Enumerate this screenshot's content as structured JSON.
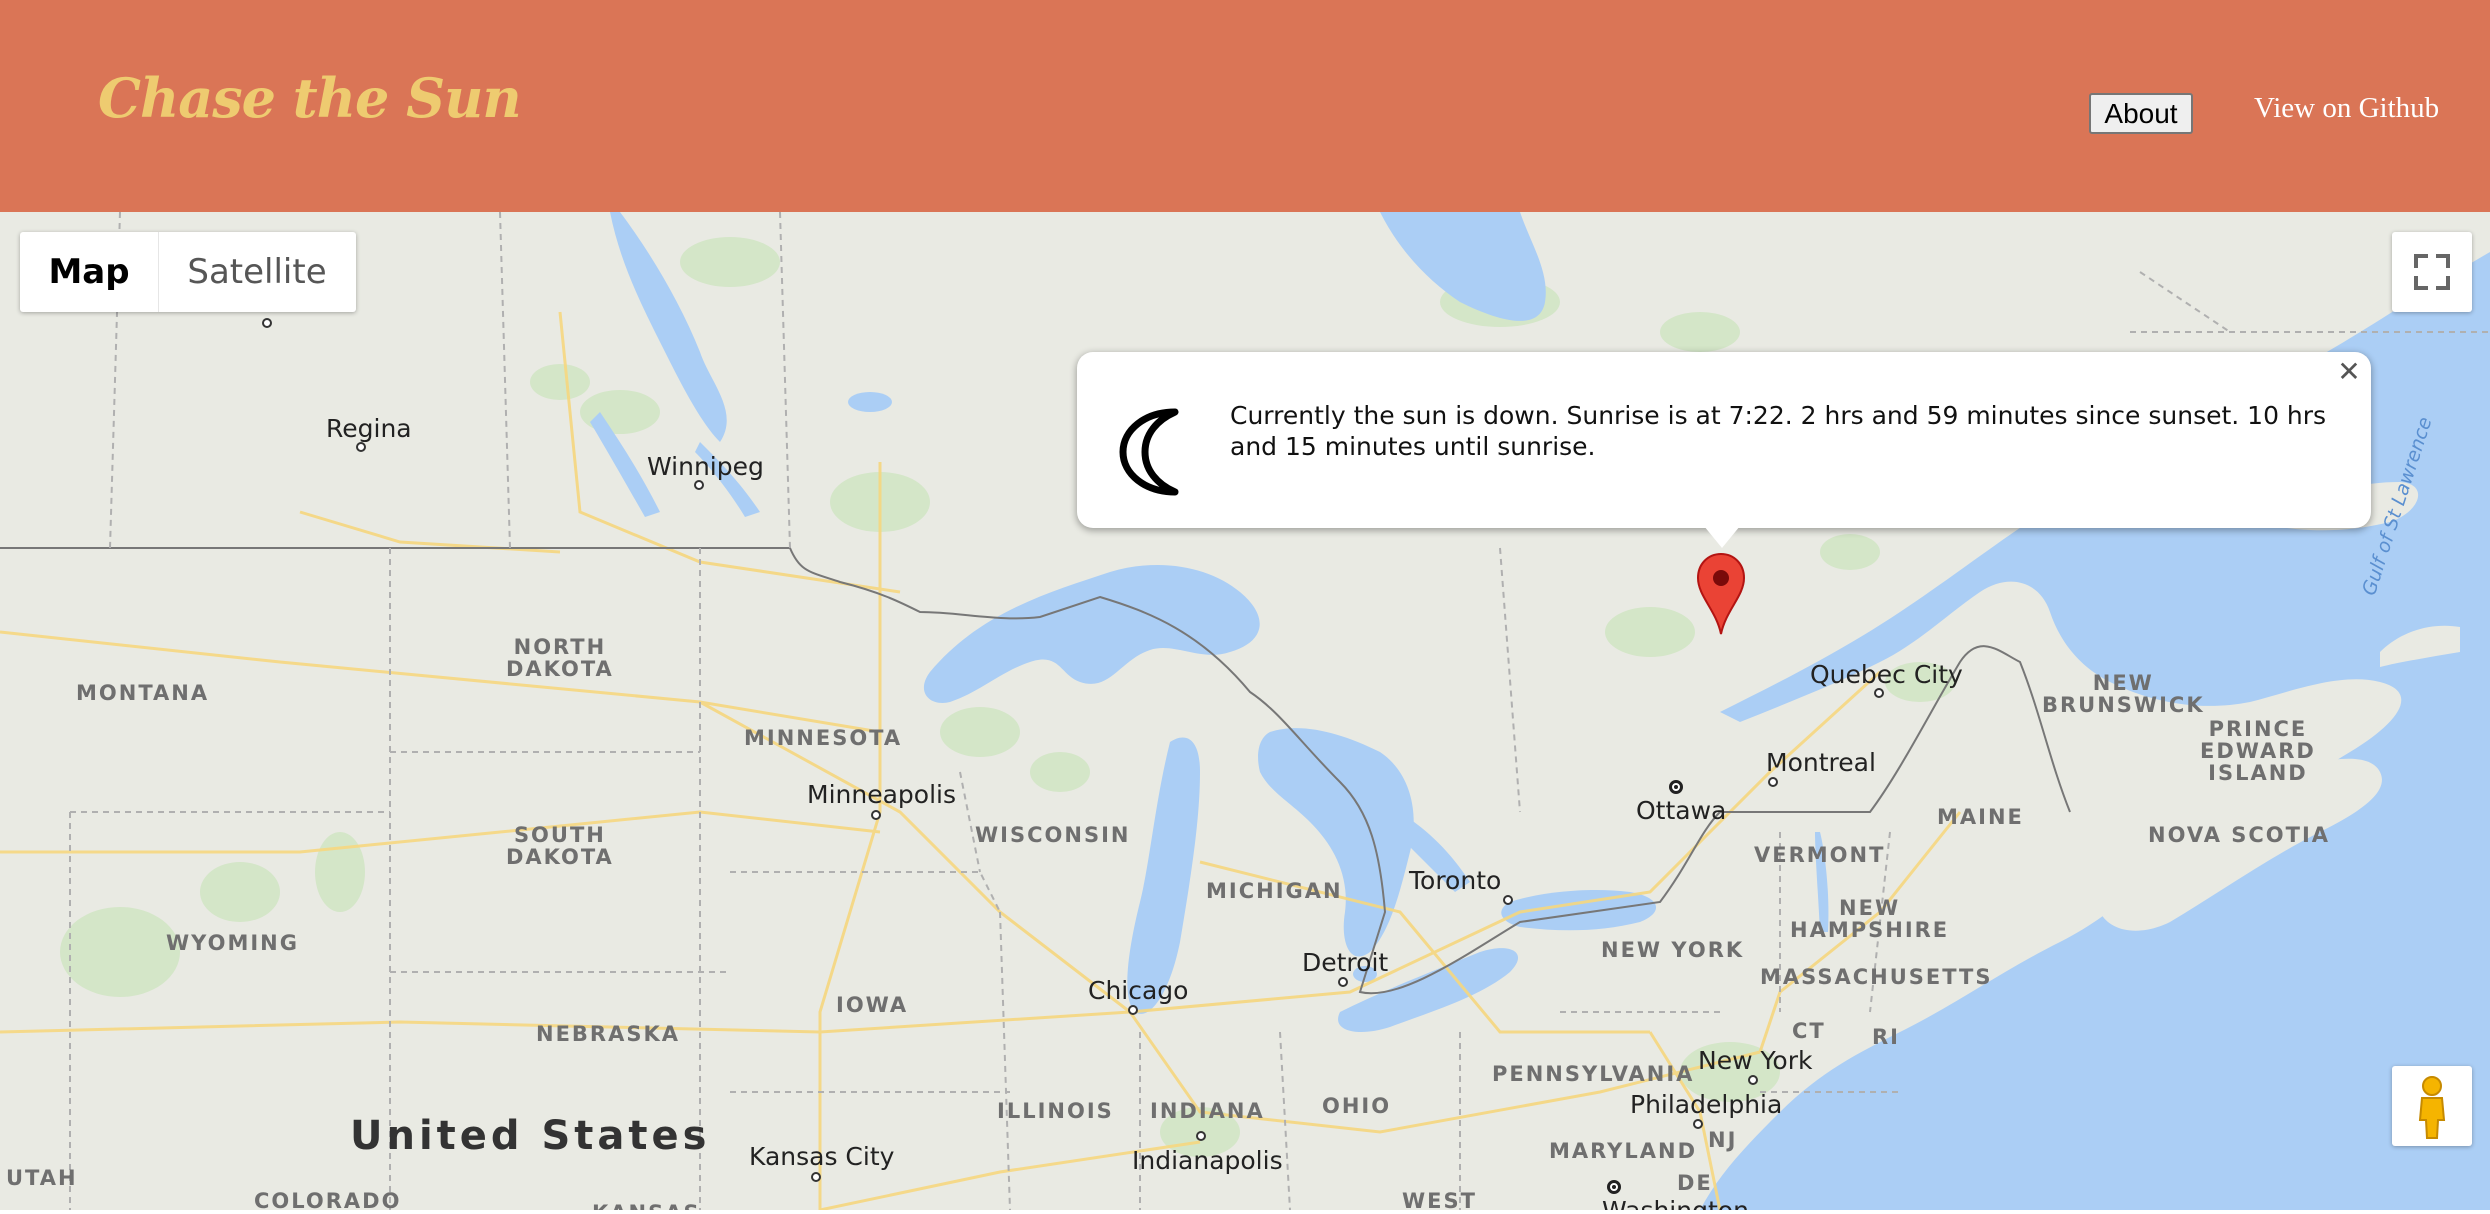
{
  "header": {
    "brand": "Chase the Sun",
    "about_label": "About",
    "github_label": "View on Github"
  },
  "map": {
    "type_control": {
      "map_label": "Map",
      "satellite_label": "Satellite",
      "selected": "Map"
    },
    "fullscreen_icon": "fullscreen-icon",
    "pegman_icon": "pegman-icon",
    "info_window": {
      "icon": "moon-icon",
      "text": "Currently the sun is down. Sunrise is at 7:22. 2 hrs and 59 minutes since sunset. 10 hrs and 15 minutes until sunrise.",
      "close_icon": "close-icon"
    },
    "marker_icon": "map-pin-icon",
    "marker_color": "#ea4335",
    "water_color": "#abcef5",
    "land_color": "#e9eae3",
    "country_label": "United States",
    "water_label": "Gulf of St Lawrence",
    "cities": [
      "Regina",
      "Winnipeg",
      "Minneapolis",
      "Chicago",
      "Detroit",
      "Toronto",
      "Ottawa",
      "Montreal",
      "Quebec City",
      "New York",
      "Philadelphia",
      "Kansas City",
      "Indianapolis",
      "Washington"
    ],
    "regions": [
      "MONTANA",
      "NORTH\nDAKOTA",
      "SOUTH\nDAKOTA",
      "MINNESOTA",
      "WISCONSIN",
      "MICHIGAN",
      "IOWA",
      "NEBRASKA",
      "WYOMING",
      "ILLINOIS",
      "INDIANA",
      "OHIO",
      "PENNSYLVANIA",
      "NEW YORK",
      "VERMONT",
      "NEW\nHAMPSHIRE",
      "MASSACHUSETTS",
      "CT",
      "RI",
      "NJ",
      "MARYLAND",
      "DE",
      "MAINE",
      "NEW\nBRUNSWICK",
      "NOVA SCOTIA",
      "PRINCE\nEDWARD\nISLAND",
      "UTAH",
      "COLORADO",
      "KANSAS",
      "WEST"
    ]
  }
}
